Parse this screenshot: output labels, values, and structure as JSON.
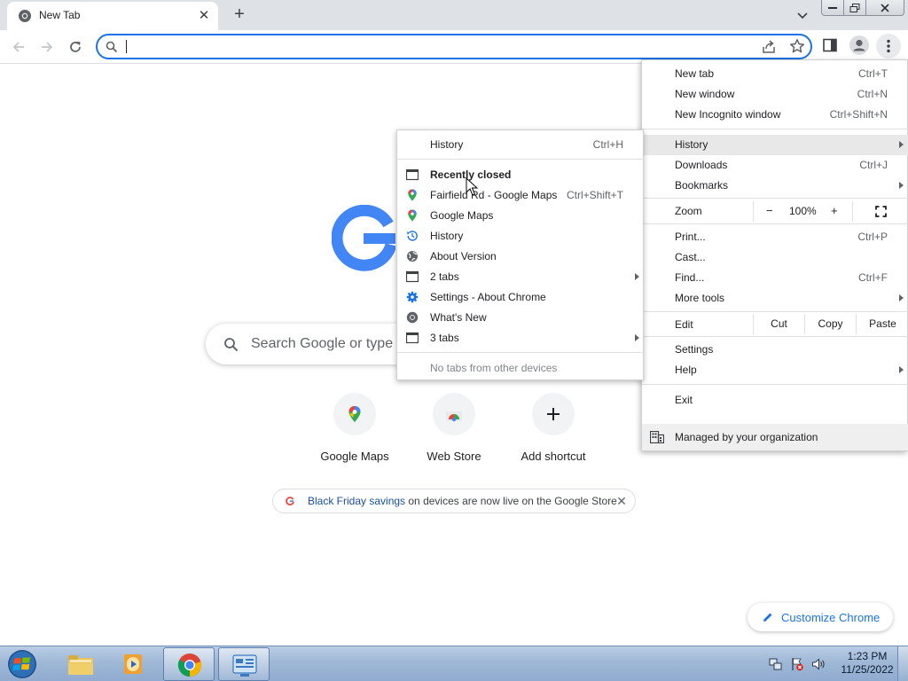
{
  "browser": {
    "tab": {
      "title": "New Tab"
    },
    "omnibox": {
      "value": "",
      "placeholder": ""
    }
  },
  "ntp": {
    "search_placeholder": "Search Google or type a URL",
    "shortcuts": [
      {
        "label": "Google Maps",
        "icon": "google-maps-icon"
      },
      {
        "label": "Web Store",
        "icon": "web-store-icon"
      },
      {
        "label": "Add shortcut",
        "icon": "plus-icon"
      }
    ],
    "promo": {
      "link_text": "Black Friday savings",
      "rest_text": " on devices are now live on the Google Store"
    },
    "customize_label": "Customize Chrome"
  },
  "main_menu": {
    "new_tab": {
      "label": "New tab",
      "shortcut": "Ctrl+T"
    },
    "new_window": {
      "label": "New window",
      "shortcut": "Ctrl+N"
    },
    "incognito": {
      "label": "New Incognito window",
      "shortcut": "Ctrl+Shift+N"
    },
    "history": {
      "label": "History"
    },
    "downloads": {
      "label": "Downloads",
      "shortcut": "Ctrl+J"
    },
    "bookmarks": {
      "label": "Bookmarks"
    },
    "zoom": {
      "label": "Zoom",
      "minus": "−",
      "value": "100%",
      "plus": "+"
    },
    "print": {
      "label": "Print...",
      "shortcut": "Ctrl+P"
    },
    "cast": {
      "label": "Cast..."
    },
    "find": {
      "label": "Find...",
      "shortcut": "Ctrl+F"
    },
    "more_tools": {
      "label": "More tools"
    },
    "edit": {
      "label": "Edit",
      "cut": "Cut",
      "copy": "Copy",
      "paste": "Paste"
    },
    "settings": {
      "label": "Settings"
    },
    "help": {
      "label": "Help"
    },
    "exit": {
      "label": "Exit"
    },
    "managed": {
      "label": "Managed by your organization"
    }
  },
  "history_menu": {
    "history": {
      "label": "History",
      "shortcut": "Ctrl+H"
    },
    "recently_closed": "Recently closed",
    "items": [
      {
        "label": "Fairfield Rd - Google Maps",
        "shortcut": "Ctrl+Shift+T",
        "icon": "google-maps-pin-icon"
      },
      {
        "label": "Google Maps",
        "icon": "google-maps-pin-icon"
      },
      {
        "label": "History",
        "icon": "history-clock-icon"
      },
      {
        "label": "About Version",
        "icon": "globe-icon"
      },
      {
        "label": "2 tabs",
        "icon": "window-icon"
      },
      {
        "label": "Settings - About Chrome",
        "icon": "settings-gear-icon"
      },
      {
        "label": "What's New",
        "icon": "chrome-icon"
      },
      {
        "label": "3 tabs",
        "icon": "window-icon"
      }
    ],
    "no_tabs": "No tabs from other devices"
  },
  "taskbar": {
    "clock_time": "1:23 PM",
    "clock_date": "11/25/2022"
  },
  "colors": {
    "accent_blue": "#1a73e8",
    "tabstrip": "#dee1e6",
    "menu_highlight": "#e8e8e8"
  }
}
